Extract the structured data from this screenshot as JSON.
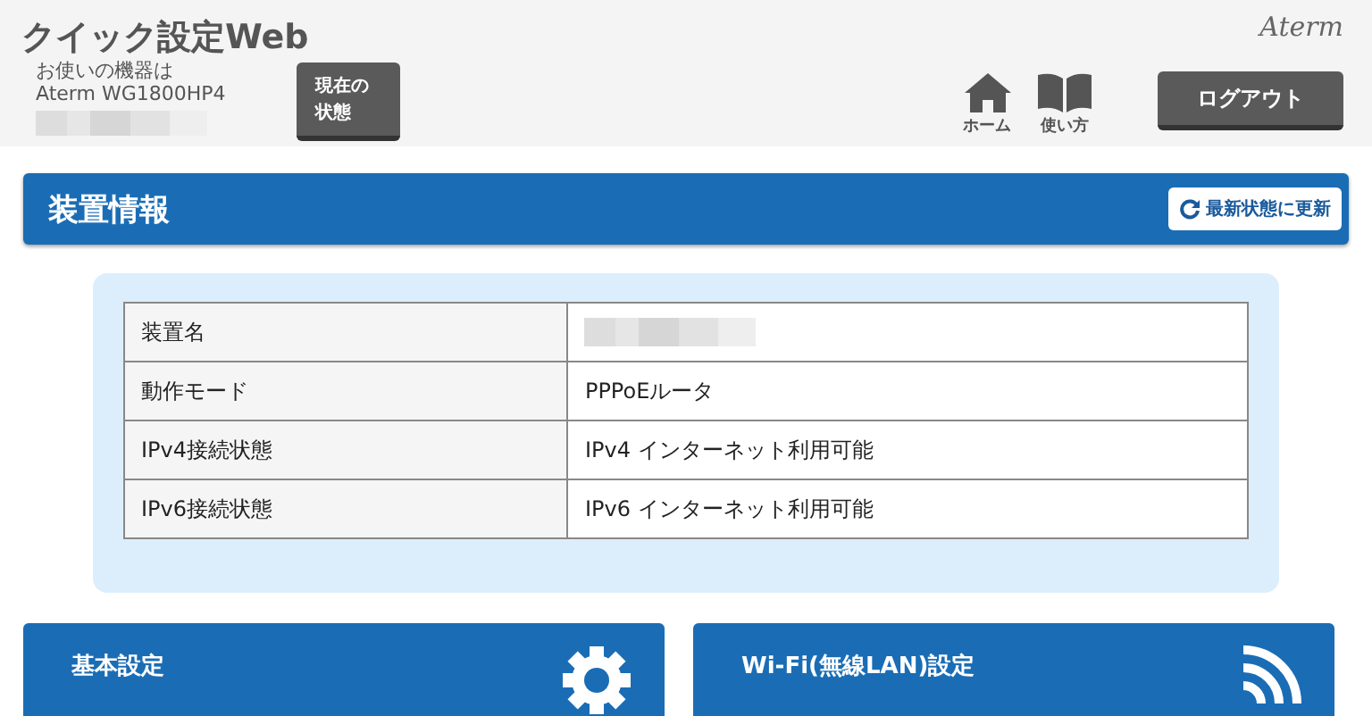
{
  "header": {
    "title": "クイック設定Web",
    "device_label": "お使いの機器は",
    "device_model": "Aterm WG1800HP4",
    "status_button": "現在の状態",
    "logo": "Aterm",
    "nav": [
      {
        "kind": "home",
        "label": "ホーム"
      },
      {
        "kind": "book",
        "label": "使い方"
      }
    ],
    "logout": "ログアウト"
  },
  "section": {
    "title": "装置情報",
    "refresh": "最新状態に更新"
  },
  "table": {
    "rows": [
      {
        "label": "装置名",
        "value": null
      },
      {
        "label": "動作モード",
        "value": "PPPoEルータ"
      },
      {
        "label": "IPv4接続状態",
        "value": "IPv4 インターネット利用可能"
      },
      {
        "label": "IPv6接続状態",
        "value": "IPv6 インターネット利用可能"
      }
    ]
  },
  "cards": [
    {
      "kind": "gear",
      "title": "基本設定"
    },
    {
      "kind": "wifi",
      "title": "Wi-Fi(無線LAN)設定"
    }
  ]
}
